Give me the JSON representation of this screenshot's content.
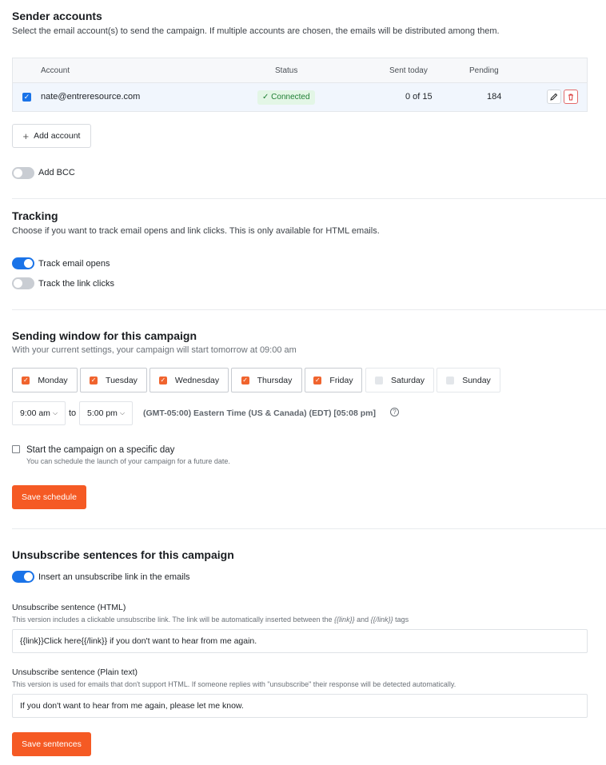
{
  "sender": {
    "title": "Sender accounts",
    "description": "Select the email account(s) to send the campaign. If multiple accounts are chosen, the emails will be distributed among them.",
    "columns": {
      "account": "Account",
      "status": "Status",
      "sent_today": "Sent today",
      "pending": "Pending"
    },
    "rows": [
      {
        "email": "nate@entreresource.com",
        "status": "Connected",
        "sent_today": "0 of 15",
        "pending": "184"
      }
    ],
    "add_account": "Add account",
    "add_bcc": "Add BCC"
  },
  "tracking": {
    "title": "Tracking",
    "description": "Choose if you want to track email opens and link clicks. This is only available for HTML emails.",
    "opens_label": "Track email opens",
    "clicks_label": "Track the link clicks",
    "opens_on": true,
    "clicks_on": false
  },
  "window": {
    "title": "Sending window for this campaign",
    "description": "With your current settings, your campaign will start tomorrow at 09:00 am",
    "days": [
      {
        "label": "Monday",
        "checked": true
      },
      {
        "label": "Tuesday",
        "checked": true
      },
      {
        "label": "Wednesday",
        "checked": true
      },
      {
        "label": "Thursday",
        "checked": true
      },
      {
        "label": "Friday",
        "checked": true
      },
      {
        "label": "Saturday",
        "checked": false
      },
      {
        "label": "Sunday",
        "checked": false
      }
    ],
    "from_time": "9:00 am",
    "to_word": "to",
    "to_time": "5:00 pm",
    "timezone": "(GMT-05:00) Eastern Time (US & Canada) (EDT) [05:08 pm]",
    "specific_day_label": "Start the campaign on a specific day",
    "specific_day_hint": "You can schedule the launch of your campaign for a future date.",
    "save": "Save schedule"
  },
  "unsubscribe": {
    "title": "Unsubscribe sentences for this campaign",
    "insert_label": "Insert an unsubscribe link in the emails",
    "html_label": "Unsubscribe sentence (HTML)",
    "html_hint_a": "This version includes a clickable unsubscribe link. The link will be automatically inserted between the ",
    "html_hint_tag1": "{{link}}",
    "html_hint_and": " and ",
    "html_hint_tag2": "{{/link}}",
    "html_hint_end": " tags",
    "html_value": "{{link}}Click here{{/link}} if you don't want to hear from me again.",
    "plain_label": "Unsubscribe sentence (Plain text)",
    "plain_hint": "This version is used for emails that don't support HTML. If someone replies with \"unsubscribe\" their response will be detected automatically.",
    "plain_value": "If you don't want to hear from me again, please let me know.",
    "save": "Save sentences"
  },
  "colors": {
    "primary": "#f55a24",
    "toggle_on": "#1a73e8",
    "connected_bg": "#e3f6e6",
    "connected_fg": "#1e7e34"
  }
}
